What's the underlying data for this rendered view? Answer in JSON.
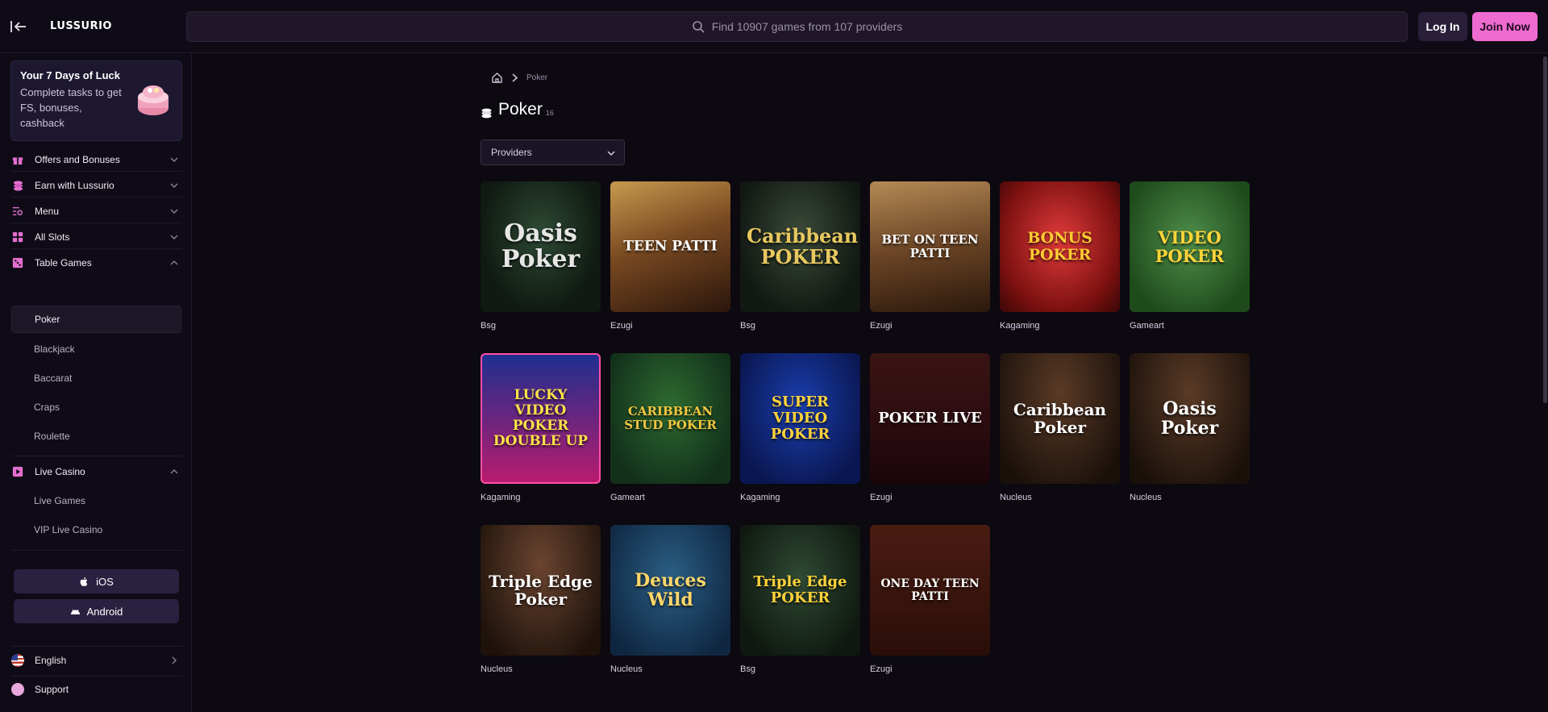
{
  "header": {
    "logo": "LUSSURIO",
    "search_placeholder": "Find 10907 games from 107 providers",
    "login": "Log In",
    "join": "Join Now"
  },
  "promo": {
    "title": "Your 7 Days of Luck",
    "text": "Complete tasks to get FS, bonuses, cashback"
  },
  "sidebar": {
    "offers": "Offers and Bonuses",
    "earn": "Earn with Lussurio",
    "menu": "Menu",
    "all_slots": "All Slots",
    "table_games": "Table Games",
    "table_sub": [
      "Poker",
      "Blackjack",
      "Baccarat",
      "Craps",
      "Roulette"
    ],
    "live_casino": "Live Casino",
    "live_sub": [
      "Live Games",
      "VIP Live Casino"
    ],
    "ios": "iOS",
    "android": "Android",
    "language": "English",
    "support": "Support"
  },
  "main": {
    "breadcrumb": "Poker",
    "title": "Poker",
    "count": "16",
    "providers_label": "Providers"
  },
  "games": [
    {
      "art": "Oasis Poker",
      "provider": "Bsg"
    },
    {
      "art": "TEEN PATTI",
      "provider": "Ezugi"
    },
    {
      "art": "Caribbean POKER",
      "provider": "Bsg"
    },
    {
      "art": "BET ON TEEN PATTI",
      "provider": "Ezugi"
    },
    {
      "art": "BONUS POKER",
      "provider": "Kagaming"
    },
    {
      "art": "VIDEO POKER",
      "provider": "Gameart"
    },
    {
      "art": "LUCKY VIDEO POKER DOUBLE UP",
      "provider": "Kagaming"
    },
    {
      "art": "CARIBBEAN STUD POKER",
      "provider": "Gameart"
    },
    {
      "art": "SUPER VIDEO POKER",
      "provider": "Kagaming"
    },
    {
      "art": "POKER LIVE",
      "provider": "Ezugi"
    },
    {
      "art": "Caribbean Poker",
      "provider": "Nucleus"
    },
    {
      "art": "Oasis Poker",
      "provider": "Nucleus"
    },
    {
      "art": "Triple Edge Poker",
      "provider": "Nucleus"
    },
    {
      "art": "Deuces Wild",
      "provider": "Nucleus"
    },
    {
      "art": "Triple Edge POKER",
      "provider": "Bsg"
    },
    {
      "art": "ONE DAY TEEN PATTI",
      "provider": "Ezugi"
    }
  ]
}
